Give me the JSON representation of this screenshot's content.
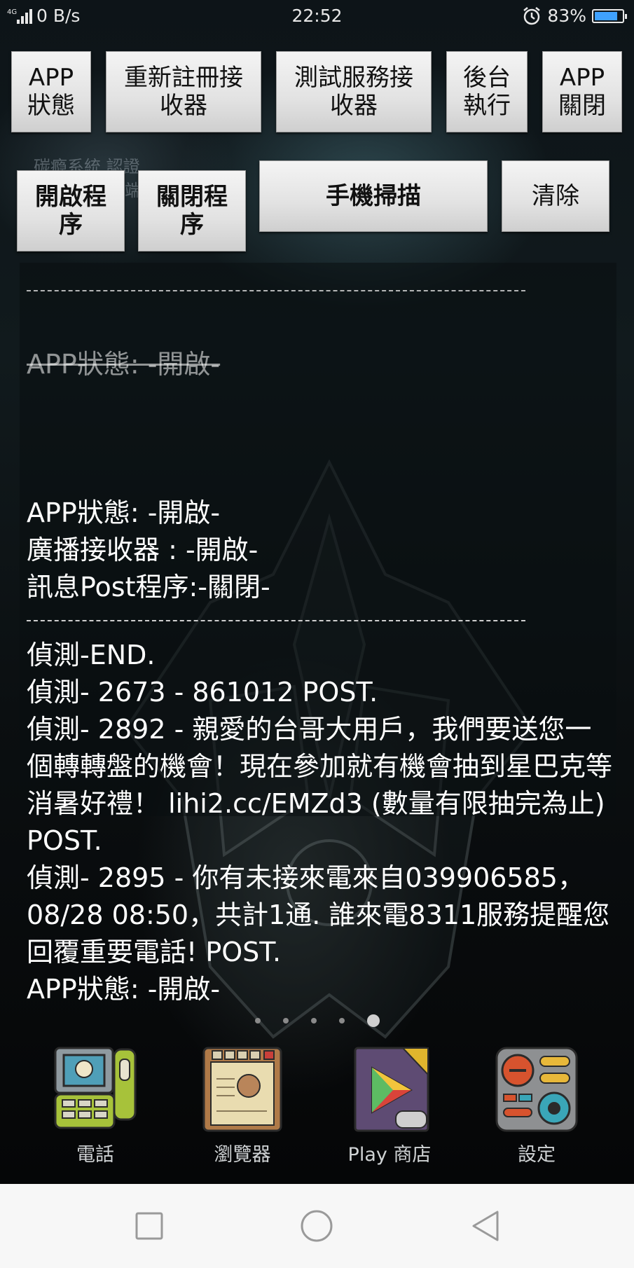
{
  "status_bar": {
    "signal": "4G",
    "speed": "0 B/s",
    "time": "22:52",
    "battery": "83%",
    "battery_level": 0.83,
    "battery_color": "#3fa2ff"
  },
  "wallpaper_text": [
    "碳瘾系統 認證",
    "端"
  ],
  "buttons_row1": {
    "app_status": "APP\n狀態",
    "reregister": "重新註冊接\n收器",
    "test_service": "測試服務接\n收器",
    "background": "後台\n執行",
    "app_close": "APP\n關閉"
  },
  "buttons_row2": {
    "open_program": "開啟程\n序",
    "close_program": "關閉程\n序",
    "phone_scan": "手機掃描",
    "clear": "清除"
  },
  "log": {
    "faded_line": "APP狀態: -開啟-",
    "status_lines": [
      "APP狀態: -開啟-",
      "廣播接收器 : -開啟-",
      "訊息Post程序:-關閉-"
    ],
    "entries": [
      "偵測-END.",
      "偵測- 2673 - 861012 POST.",
      "偵測- 2892 - 親愛的台哥大用戶，我們要送您一個轉轉盤的機會！現在參加就有機會抽到星巴克等消暑好禮！ lihi2.cc/EMZd3 (數量有限抽完為止) POST.",
      "偵測- 2895 - 你有未接來電來自039906585，08/28 08:50，共計1通. 誰來電8311服務提醒您回覆重要電話! POST.",
      "APP狀態: -開啟-"
    ]
  },
  "dock": {
    "phone": "電話",
    "browser": "瀏覽器",
    "play_store": "Play 商店",
    "settings": "設定"
  }
}
